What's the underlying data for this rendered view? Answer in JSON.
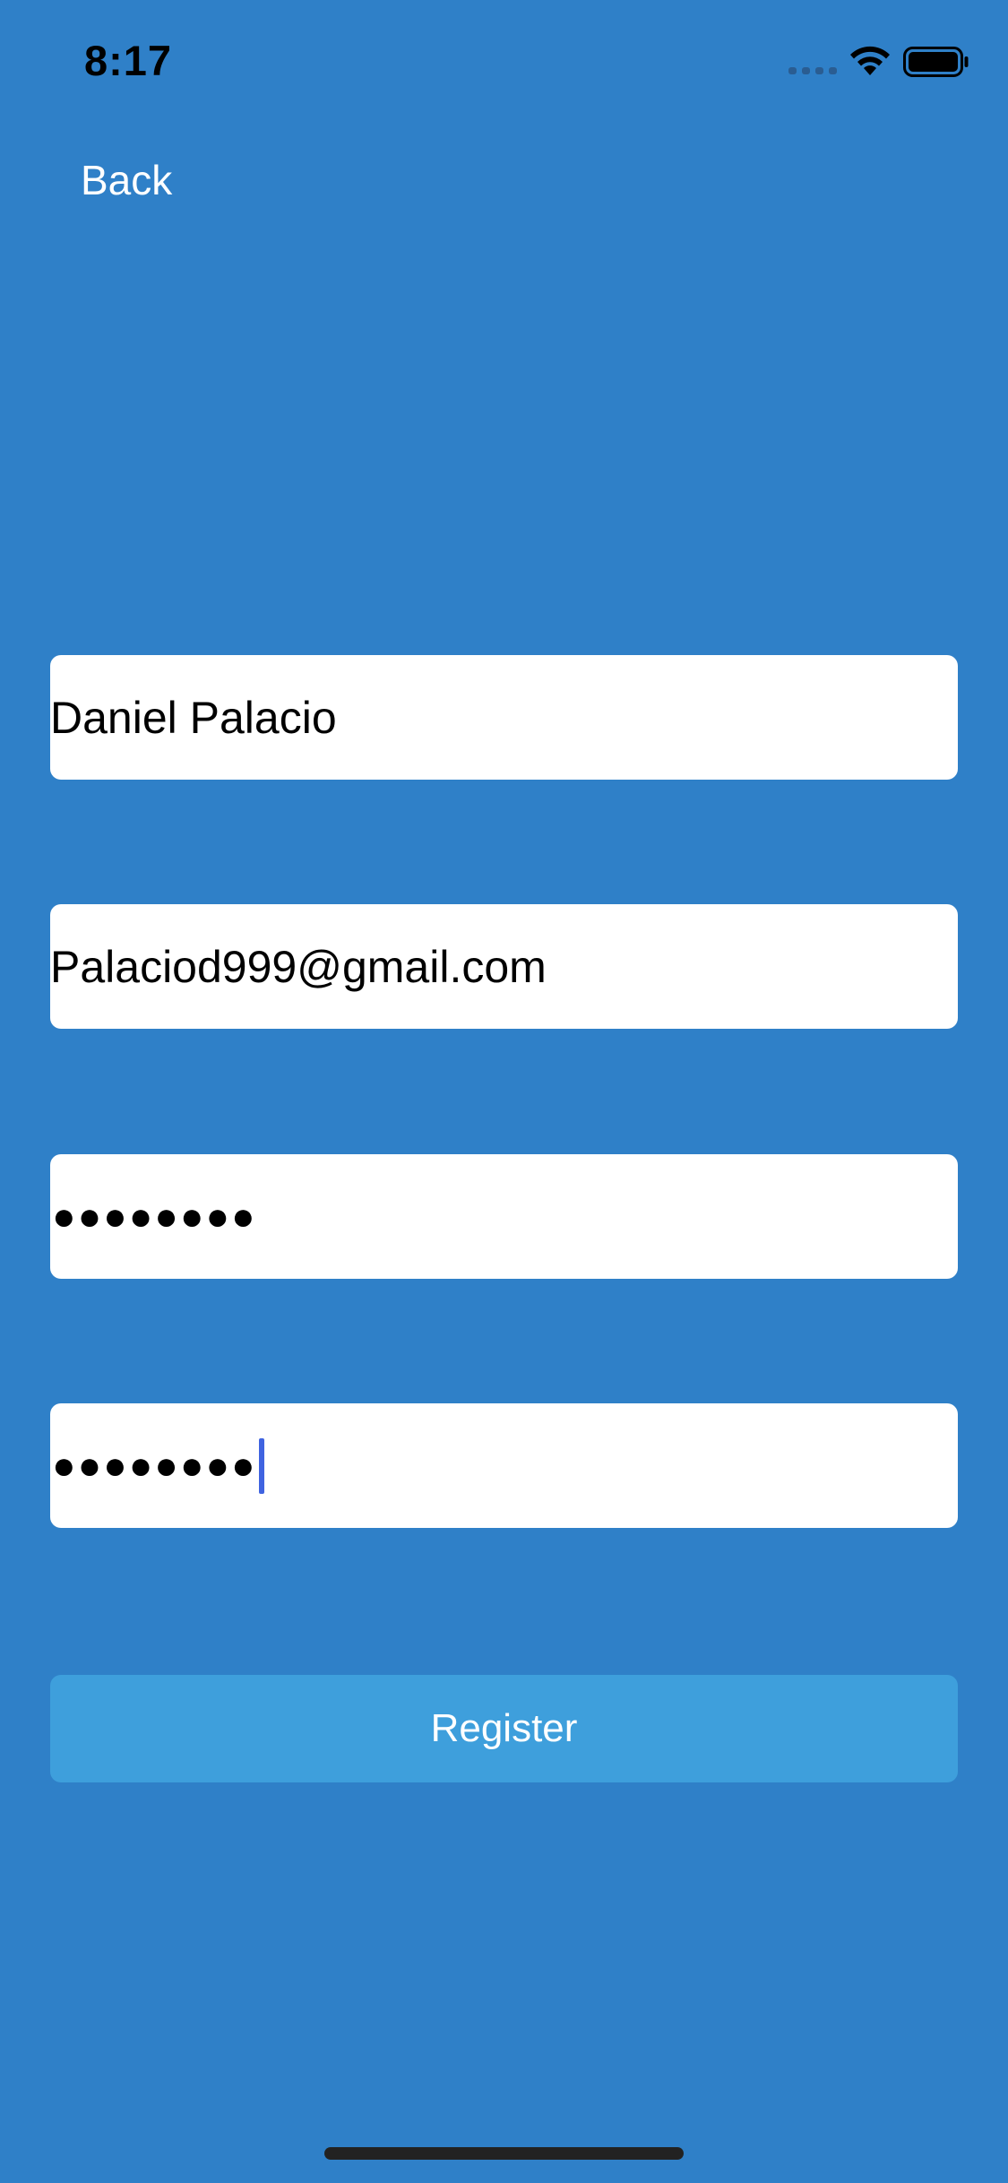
{
  "status_bar": {
    "time": "8:17",
    "icons": [
      "signal-icon",
      "wifi-icon",
      "battery-icon"
    ]
  },
  "nav": {
    "back_label": "Back"
  },
  "form": {
    "name_value": "Daniel Palacio",
    "email_value": "Palaciod999@gmail.com",
    "password_value": "●●●●●●●●",
    "confirm_password_value": "●●●●●●●●",
    "register_label": "Register"
  },
  "colors": {
    "background": "#2f80c8",
    "button": "#3e9fdc",
    "caret": "#3f63e0"
  }
}
